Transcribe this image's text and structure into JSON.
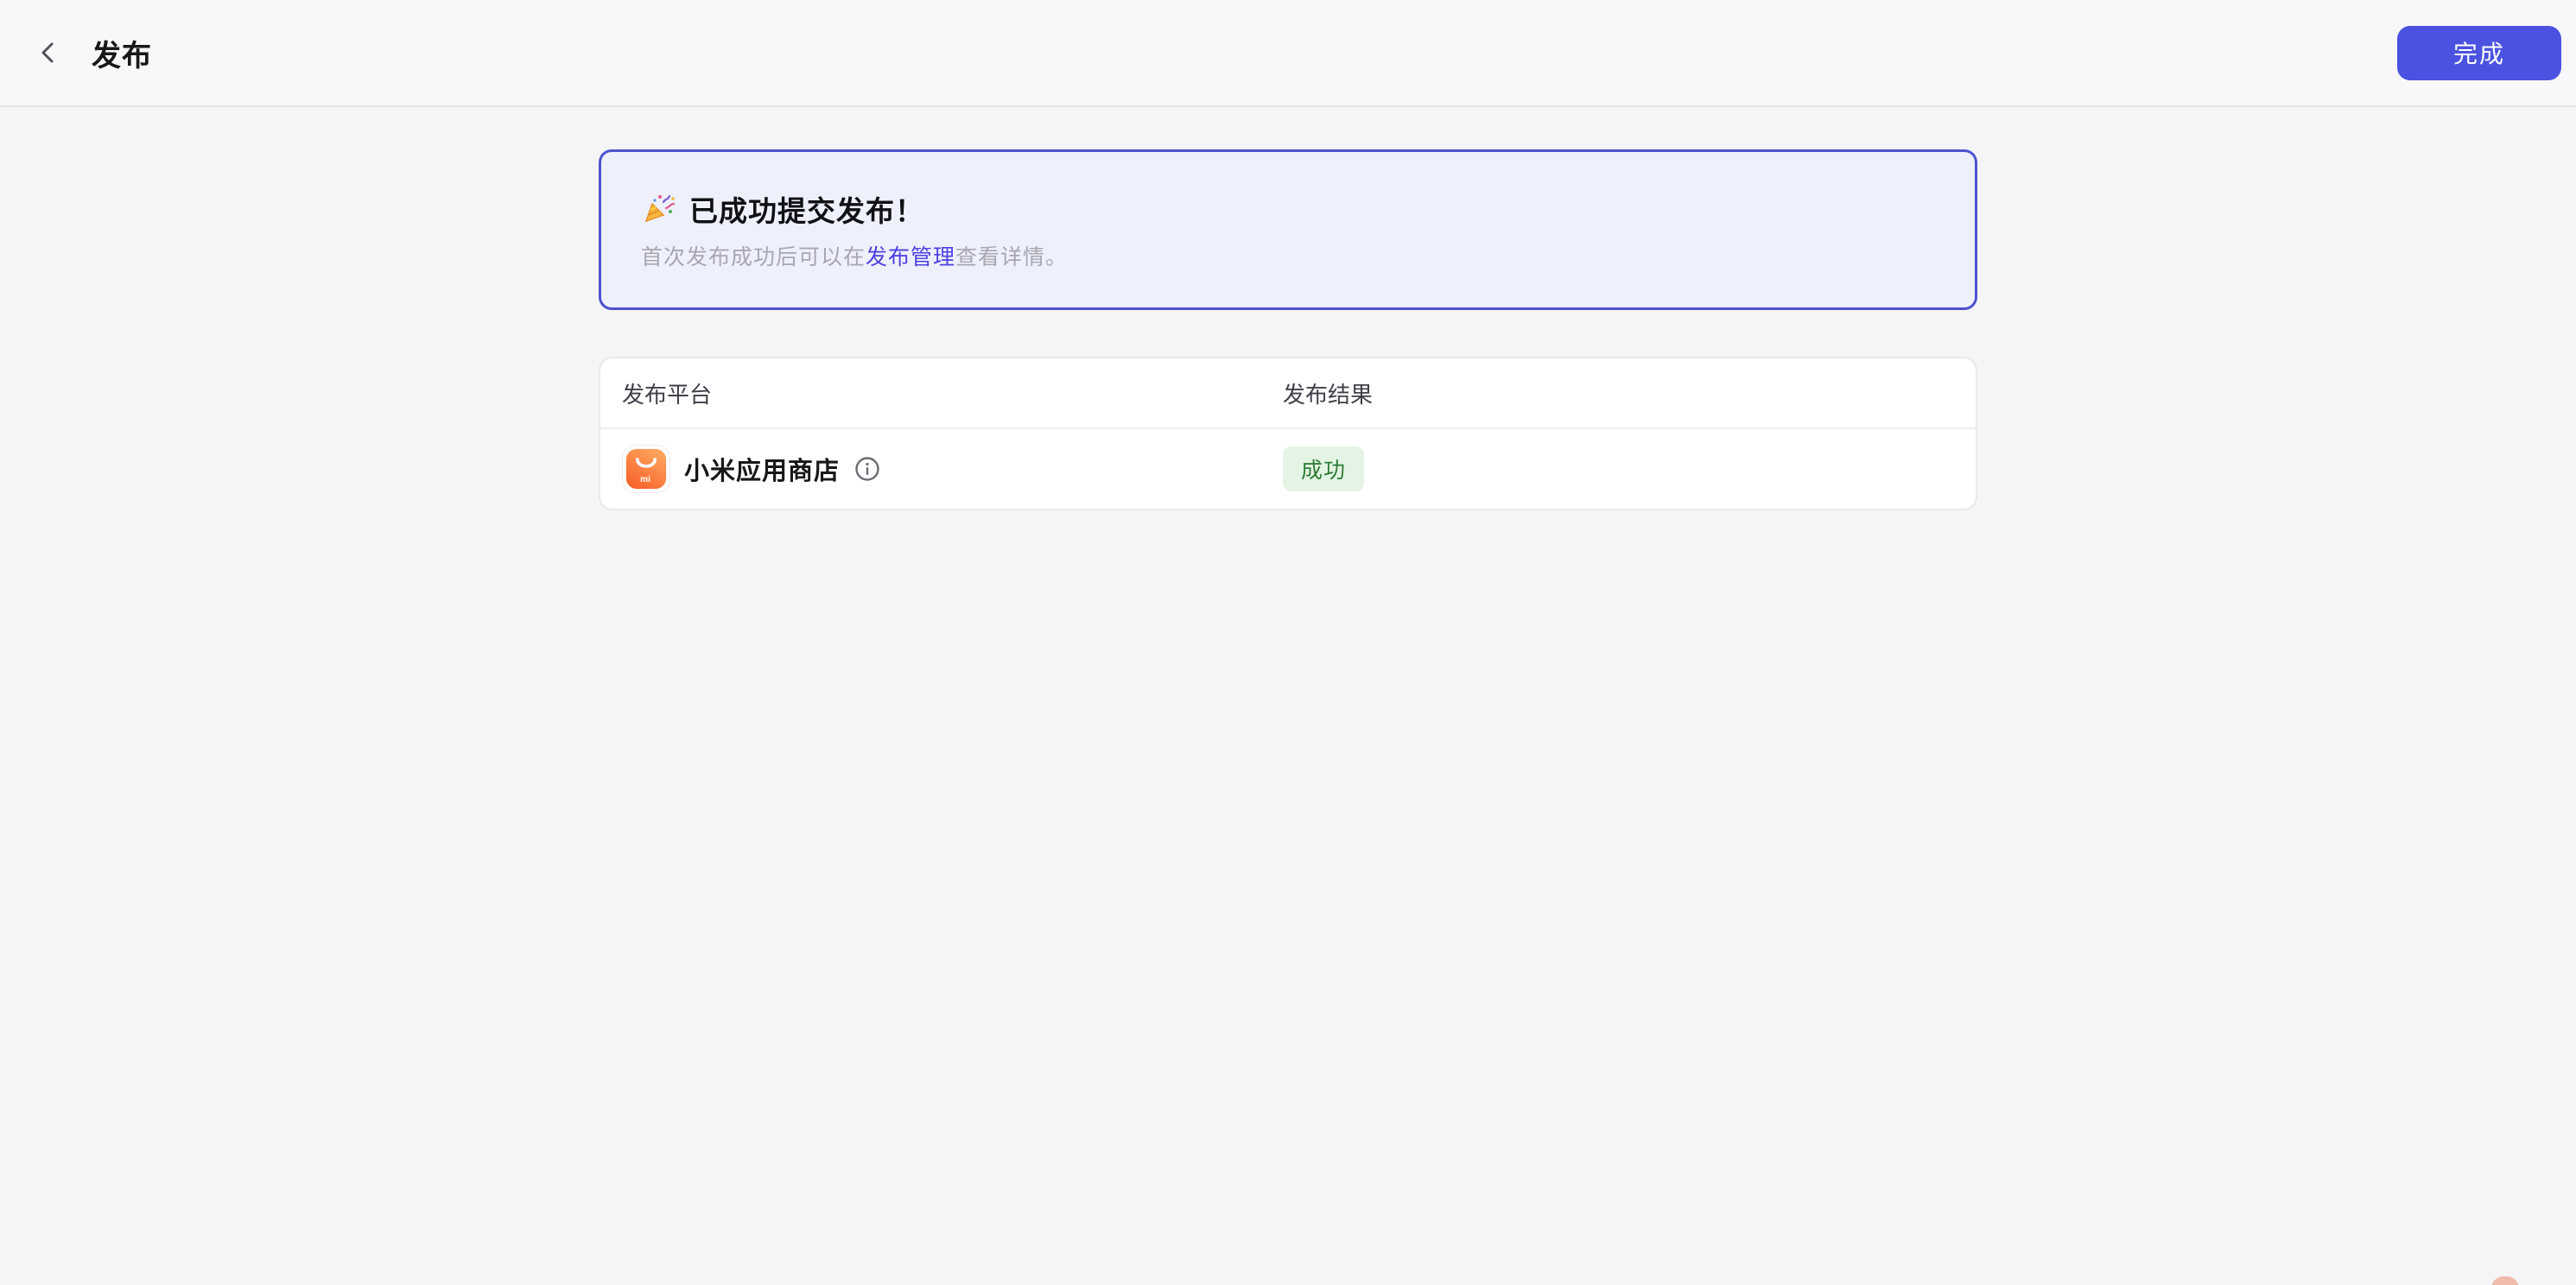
{
  "header": {
    "title": "发布",
    "done_button": "完成"
  },
  "banner": {
    "emoji": "🎉",
    "title": "已成功提交发布！",
    "subtitle_prefix": "首次发布成功后可以在",
    "subtitle_link": "发布管理",
    "subtitle_suffix": "查看详情。"
  },
  "table": {
    "columns": [
      {
        "label": "发布平台"
      },
      {
        "label": "发布结果"
      }
    ],
    "rows": [
      {
        "platform": "小米应用商店",
        "platform_icon": "xiaomi-app-store-icon",
        "info_icon": "info-circle-icon",
        "result": "成功",
        "result_status": "success"
      }
    ]
  },
  "colors": {
    "accent_indigo": "#4b52e2",
    "link_indigo": "#4c3fe2",
    "banner_border": "#4d53ce",
    "banner_bg": "#eef0fb",
    "page_bg": "#f5f5f7",
    "success_text": "#2e7d36",
    "success_bg": "#e4f4e4",
    "xiaomi_orange_top": "#ffa75f",
    "xiaomi_orange_bottom": "#f8622a"
  }
}
